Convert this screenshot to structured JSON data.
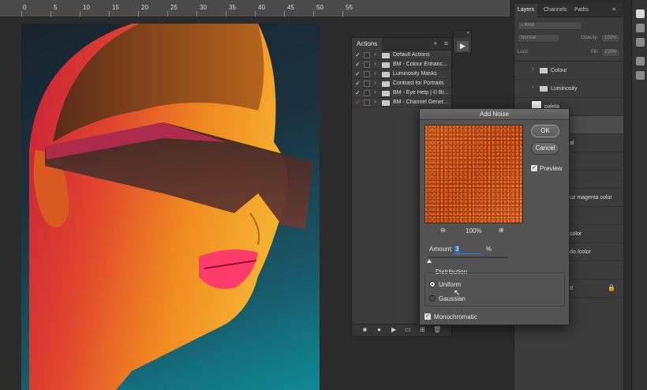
{
  "ruler": {
    "marks": [
      "0",
      "5",
      "10",
      "15",
      "20",
      "25",
      "30",
      "35",
      "40",
      "45",
      "50",
      "55"
    ]
  },
  "actions_panel": {
    "tab": "Actions",
    "items": [
      {
        "label": "Default Actions",
        "checked": true
      },
      {
        "label": "BM - Colour Enhanc...",
        "checked": true
      },
      {
        "label": "Luminosity Masks",
        "checked": true
      },
      {
        "label": "Contrast for Portraits",
        "checked": true
      },
      {
        "label": "BM - Eye Help | © Br...",
        "checked": true
      },
      {
        "label": "BM - Channel Gener...",
        "checked": true
      }
    ]
  },
  "layers_panel": {
    "tabs": [
      "Layers",
      "Channels",
      "Paths"
    ],
    "search_placeholder": "Kind",
    "blend_mode": "Normal",
    "opacity_label": "Opacity:",
    "opacity_value": "100%",
    "lock_label": "Lock:",
    "fill_label": "Fill:",
    "fill_value": "100%",
    "layers": [
      {
        "name": "Colour",
        "type": "group"
      },
      {
        "name": "Luminosity",
        "type": "group"
      },
      {
        "name": "paleta",
        "type": "layer"
      },
      {
        "name": "",
        "type": "layer"
      },
      {
        "name": "al",
        "type": "layer"
      },
      {
        "name": "",
        "type": "layer"
      },
      {
        "name": "",
        "type": "layer"
      },
      {
        "name": "uz magenta color",
        "type": "layer"
      },
      {
        "name": "",
        "type": "layer"
      },
      {
        "name": "color",
        "type": "layer"
      },
      {
        "name": "do /color",
        "type": "layer"
      },
      {
        "name": "",
        "type": "layer"
      },
      {
        "name": "d",
        "type": "layer"
      }
    ]
  },
  "dialog": {
    "title": "Add Noise",
    "ok_label": "OK",
    "cancel_label": "Cancel",
    "preview_label": "Preview",
    "preview_checked": true,
    "zoom": "100%",
    "amount_label": "Amount:",
    "amount_value": "3",
    "amount_unit": "%",
    "distribution_label": "Distribution",
    "uniform_label": "Uniform",
    "gaussian_label": "Gaussian",
    "selected_distribution": "Uniform",
    "monochromatic_label": "Monochromatic",
    "monochromatic_checked": true
  }
}
